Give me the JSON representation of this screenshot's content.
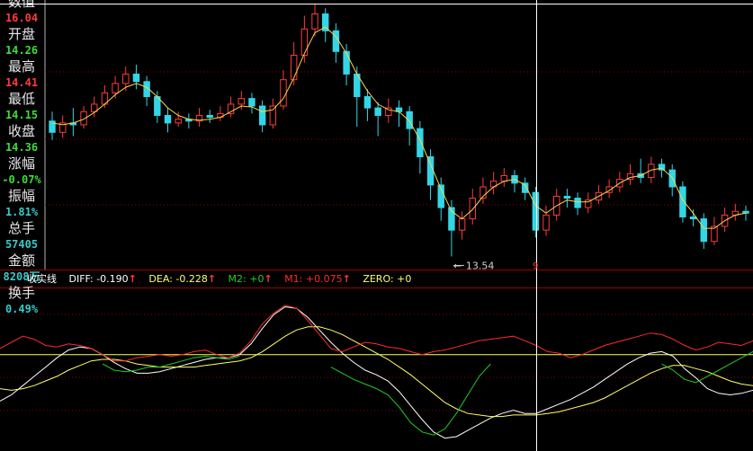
{
  "info_panel": [
    {
      "label": "数值",
      "value": "16.04",
      "color": "#ff3b3b"
    },
    {
      "label": "开盘",
      "value": "14.26",
      "color": "#3ddc3d"
    },
    {
      "label": "最高",
      "value": "14.41",
      "color": "#ff3b3b"
    },
    {
      "label": "最低",
      "value": "14.15",
      "color": "#3ddc3d"
    },
    {
      "label": "收盘",
      "value": "14.36",
      "color": "#3ddc3d"
    },
    {
      "label": "涨幅",
      "value": "-0.07%",
      "color": "#3ddc3d"
    },
    {
      "label": "振幅",
      "value": "1.81%",
      "color": "#33cccc"
    },
    {
      "label": "总手",
      "value": "57405",
      "color": "#33cccc"
    },
    {
      "label": "金额",
      "value": "8208万",
      "color": "#33cccc"
    },
    {
      "label": "换手",
      "value": "0.49%",
      "color": "#33cccc"
    }
  ],
  "legend": {
    "name": "收实线",
    "diff": "DIFF: -0.190",
    "dea": "DEA: -0.228",
    "m2": "M2: +0",
    "m1": "M1: +0.075",
    "zero": "ZERO: +0",
    "arrow": "↑"
  },
  "colors": {
    "up": "#ff3b3b",
    "down": "#33d6e6",
    "grid": "#8b0000",
    "white": "#ffffff",
    "yellow": "#ffff66",
    "green": "#22cc22",
    "red": "#ff2a2a",
    "cursor": "#ffffff"
  },
  "chart_data": [
    {
      "type": "candlestick",
      "low_marker": "13.54",
      "cursor_label": "9",
      "ylim": [
        13.3,
        16.1
      ],
      "candles": [
        [
          14.86,
          14.74,
          14.96,
          14.66
        ],
        [
          14.74,
          14.84,
          14.92,
          14.68
        ],
        [
          14.84,
          14.82,
          15.0,
          14.7
        ],
        [
          14.82,
          14.96,
          15.02,
          14.78
        ],
        [
          14.96,
          15.04,
          15.12,
          14.9
        ],
        [
          15.04,
          15.16,
          15.24,
          15.0
        ],
        [
          15.16,
          15.26,
          15.34,
          15.1
        ],
        [
          15.26,
          15.36,
          15.44,
          15.18
        ],
        [
          15.36,
          15.28,
          15.46,
          15.2
        ],
        [
          15.28,
          15.12,
          15.34,
          15.02
        ],
        [
          15.12,
          14.92,
          15.18,
          14.84
        ],
        [
          14.92,
          14.84,
          15.0,
          14.74
        ],
        [
          14.84,
          14.88,
          14.96,
          14.8
        ],
        [
          14.88,
          14.86,
          14.94,
          14.78
        ],
        [
          14.86,
          14.92,
          15.0,
          14.8
        ],
        [
          14.92,
          14.9,
          14.98,
          14.84
        ],
        [
          14.9,
          14.94,
          15.02,
          14.86
        ],
        [
          14.94,
          15.04,
          15.12,
          14.9
        ],
        [
          15.04,
          15.1,
          15.18,
          14.98
        ],
        [
          15.1,
          15.02,
          15.16,
          14.94
        ],
        [
          15.02,
          14.82,
          15.08,
          14.74
        ],
        [
          14.82,
          15.02,
          15.1,
          14.78
        ],
        [
          15.02,
          15.3,
          15.4,
          14.98
        ],
        [
          15.3,
          15.56,
          15.7,
          15.24
        ],
        [
          15.56,
          15.84,
          15.98,
          15.48
        ],
        [
          15.84,
          16.0,
          16.1,
          15.76
        ],
        [
          16.0,
          15.82,
          16.06,
          15.7
        ],
        [
          15.82,
          15.6,
          15.9,
          15.48
        ],
        [
          15.6,
          15.36,
          15.68,
          15.24
        ],
        [
          15.36,
          15.12,
          15.44,
          14.8
        ],
        [
          15.12,
          15.0,
          15.2,
          14.86
        ],
        [
          15.0,
          14.92,
          15.06,
          14.7
        ],
        [
          14.92,
          15.0,
          15.1,
          14.84
        ],
        [
          15.0,
          14.96,
          15.08,
          14.8
        ],
        [
          14.96,
          14.78,
          15.02,
          14.6
        ],
        [
          14.78,
          14.48,
          14.86,
          14.3
        ],
        [
          14.48,
          14.18,
          14.56,
          14.02
        ],
        [
          14.18,
          13.94,
          14.26,
          13.8
        ],
        [
          13.94,
          13.7,
          14.02,
          13.42
        ],
        [
          13.7,
          13.82,
          13.9,
          13.6
        ],
        [
          13.82,
          14.04,
          14.14,
          13.76
        ],
        [
          14.04,
          14.16,
          14.26,
          13.98
        ],
        [
          14.16,
          14.22,
          14.32,
          14.08
        ],
        [
          14.22,
          14.28,
          14.36,
          14.16
        ],
        [
          14.28,
          14.2,
          14.34,
          14.1
        ],
        [
          14.2,
          14.1,
          14.26,
          14.02
        ],
        [
          14.1,
          13.7,
          14.16,
          13.62
        ],
        [
          13.7,
          13.86,
          13.96,
          13.64
        ],
        [
          13.86,
          14.06,
          14.14,
          13.8
        ],
        [
          14.06,
          14.04,
          14.14,
          13.94
        ],
        [
          14.04,
          13.94,
          14.1,
          13.86
        ],
        [
          13.94,
          14.02,
          14.1,
          13.88
        ],
        [
          14.02,
          14.1,
          14.18,
          13.98
        ],
        [
          14.1,
          14.16,
          14.24,
          14.04
        ],
        [
          14.16,
          14.24,
          14.32,
          14.1
        ],
        [
          14.24,
          14.3,
          14.4,
          14.18
        ],
        [
          14.3,
          14.26,
          14.46,
          14.2
        ],
        [
          14.26,
          14.4,
          14.48,
          14.2
        ],
        [
          14.4,
          14.34,
          14.46,
          14.26
        ],
        [
          14.34,
          14.16,
          14.4,
          14.06
        ],
        [
          14.16,
          13.84,
          14.22,
          13.78
        ],
        [
          13.84,
          13.82,
          13.92,
          13.74
        ],
        [
          13.82,
          13.58,
          13.88,
          13.5
        ],
        [
          13.58,
          13.74,
          13.84,
          13.54
        ],
        [
          13.74,
          13.86,
          13.94,
          13.68
        ],
        [
          13.86,
          13.9,
          13.98,
          13.8
        ],
        [
          13.9,
          13.88,
          13.96,
          13.8
        ]
      ],
      "ma": [
        14.84,
        14.82,
        14.84,
        14.88,
        14.95,
        15.04,
        15.14,
        15.22,
        15.26,
        15.22,
        15.12,
        15.0,
        14.92,
        14.88,
        14.87,
        14.88,
        14.9,
        14.96,
        15.02,
        15.01,
        14.96,
        14.98,
        15.1,
        15.32,
        15.58,
        15.8,
        15.86,
        15.76,
        15.58,
        15.36,
        15.18,
        15.04,
        14.98,
        14.96,
        14.86,
        14.66,
        14.4,
        14.14,
        13.9,
        13.82,
        13.92,
        14.06,
        14.16,
        14.22,
        14.24,
        14.18,
        13.96,
        13.88,
        13.96,
        14.02,
        14.0,
        14.0,
        14.06,
        14.12,
        14.2,
        14.26,
        14.28,
        14.34,
        14.36,
        14.26,
        14.02,
        13.88,
        13.72,
        13.72,
        13.8,
        13.86,
        13.88
      ]
    },
    {
      "type": "line",
      "series_names": [
        "DIFF",
        "DEA",
        "M2",
        "M1",
        "ZERO"
      ],
      "ylim": [
        -0.6,
        0.4
      ],
      "zero_line": 0,
      "series": [
        {
          "name": "DIFF",
          "color": "#ffffff",
          "values": [
            -0.3,
            -0.26,
            -0.2,
            -0.14,
            -0.08,
            -0.02,
            0.03,
            0.05,
            0.04,
            0.0,
            -0.05,
            -0.09,
            -0.12,
            -0.12,
            -0.11,
            -0.09,
            -0.07,
            -0.05,
            -0.03,
            -0.02,
            -0.02,
            0.0,
            0.07,
            0.17,
            0.26,
            0.31,
            0.3,
            0.24,
            0.16,
            0.08,
            0.01,
            -0.05,
            -0.1,
            -0.13,
            -0.17,
            -0.24,
            -0.33,
            -0.42,
            -0.5,
            -0.54,
            -0.53,
            -0.49,
            -0.45,
            -0.41,
            -0.38,
            -0.36,
            -0.38,
            -0.38,
            -0.35,
            -0.32,
            -0.29,
            -0.25,
            -0.21,
            -0.16,
            -0.11,
            -0.06,
            -0.02,
            0.01,
            0.02,
            -0.01,
            -0.09,
            -0.15,
            -0.22,
            -0.25,
            -0.26,
            -0.25,
            -0.23
          ]
        },
        {
          "name": "DEA",
          "color": "#ffff66",
          "values": [
            -0.22,
            -0.23,
            -0.22,
            -0.2,
            -0.17,
            -0.14,
            -0.1,
            -0.07,
            -0.04,
            -0.03,
            -0.03,
            -0.04,
            -0.06,
            -0.07,
            -0.08,
            -0.08,
            -0.08,
            -0.08,
            -0.07,
            -0.06,
            -0.05,
            -0.04,
            -0.02,
            0.02,
            0.07,
            0.12,
            0.16,
            0.18,
            0.18,
            0.16,
            0.13,
            0.09,
            0.05,
            0.01,
            -0.03,
            -0.08,
            -0.13,
            -0.19,
            -0.25,
            -0.31,
            -0.35,
            -0.38,
            -0.39,
            -0.4,
            -0.4,
            -0.39,
            -0.39,
            -0.39,
            -0.38,
            -0.37,
            -0.35,
            -0.33,
            -0.31,
            -0.28,
            -0.24,
            -0.2,
            -0.16,
            -0.12,
            -0.09,
            -0.07,
            -0.07,
            -0.09,
            -0.11,
            -0.14,
            -0.17,
            -0.19,
            -0.2
          ]
        },
        {
          "name": "M1",
          "color": "#ff2a2a",
          "values": [
            0.04,
            0.08,
            0.12,
            0.1,
            0.06,
            0.05,
            0.07,
            0.06,
            0.04,
            0.0,
            -0.04,
            -0.04,
            -0.02,
            -0.01,
            0.0,
            -0.01,
            0.0,
            0.02,
            0.03,
            0.0,
            -0.02,
            0.01,
            0.09,
            0.2,
            0.27,
            0.32,
            0.3,
            0.22,
            0.13,
            0.04,
            0.02,
            0.05,
            0.08,
            0.07,
            0.05,
            0.04,
            0.02,
            0.0,
            0.02,
            0.03,
            0.05,
            0.07,
            0.09,
            0.1,
            0.11,
            0.12,
            0.09,
            0.06,
            0.02,
            0.01,
            -0.02,
            0.0,
            0.03,
            0.06,
            0.08,
            0.1,
            0.12,
            0.14,
            0.13,
            0.1,
            0.06,
            0.03,
            0.05,
            0.08,
            0.07,
            0.06,
            0.09
          ]
        },
        {
          "name": "M2",
          "color": "#22cc22",
          "values": [
            null,
            null,
            null,
            null,
            null,
            null,
            null,
            null,
            null,
            -0.06,
            -0.1,
            -0.11,
            -0.1,
            -0.08,
            -0.08,
            -0.06,
            -0.04,
            -0.02,
            -0.01,
            -0.02,
            -0.03,
            -0.01,
            null,
            null,
            null,
            null,
            null,
            null,
            null,
            -0.08,
            -0.12,
            -0.16,
            -0.19,
            -0.22,
            -0.26,
            -0.34,
            -0.44,
            -0.5,
            -0.52,
            -0.48,
            -0.38,
            -0.26,
            -0.14,
            -0.06,
            null,
            null,
            null,
            null,
            null,
            null,
            null,
            null,
            null,
            null,
            null,
            null,
            null,
            null,
            -0.06,
            -0.1,
            -0.16,
            -0.18,
            -0.14,
            -0.1,
            -0.06,
            -0.02,
            0.02
          ]
        }
      ]
    }
  ]
}
